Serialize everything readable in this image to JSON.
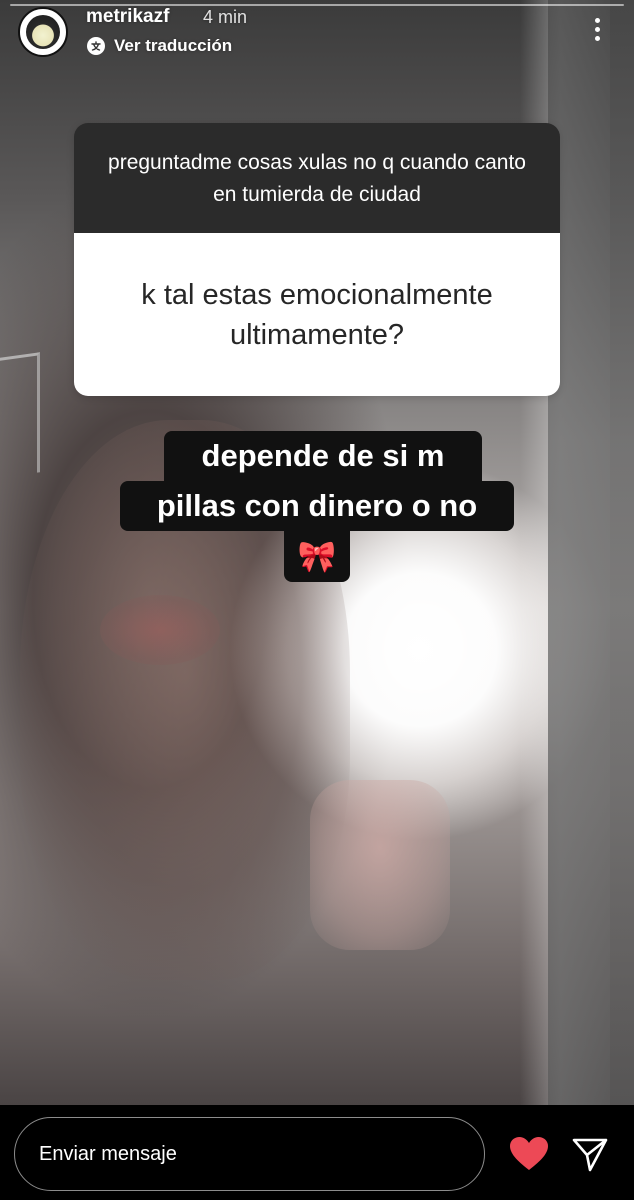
{
  "header": {
    "username": "metrikazf",
    "time": "4 min",
    "translate_label": "Ver traducción"
  },
  "question_sticker": {
    "prompt": "preguntadme cosas xulas no q cuando canto en tumierda de ciudad",
    "question": "k tal estas emocionalmente ultimamente?"
  },
  "answer": {
    "line1": "depende de si m",
    "line2": "pillas con dinero o no",
    "emoji": "🎀"
  },
  "footer": {
    "message_placeholder": "Enviar mensaje",
    "like_color": "#ED4956"
  },
  "icons": [
    "avatar",
    "translate-icon",
    "more-options-icon",
    "heart-icon",
    "send-icon"
  ]
}
